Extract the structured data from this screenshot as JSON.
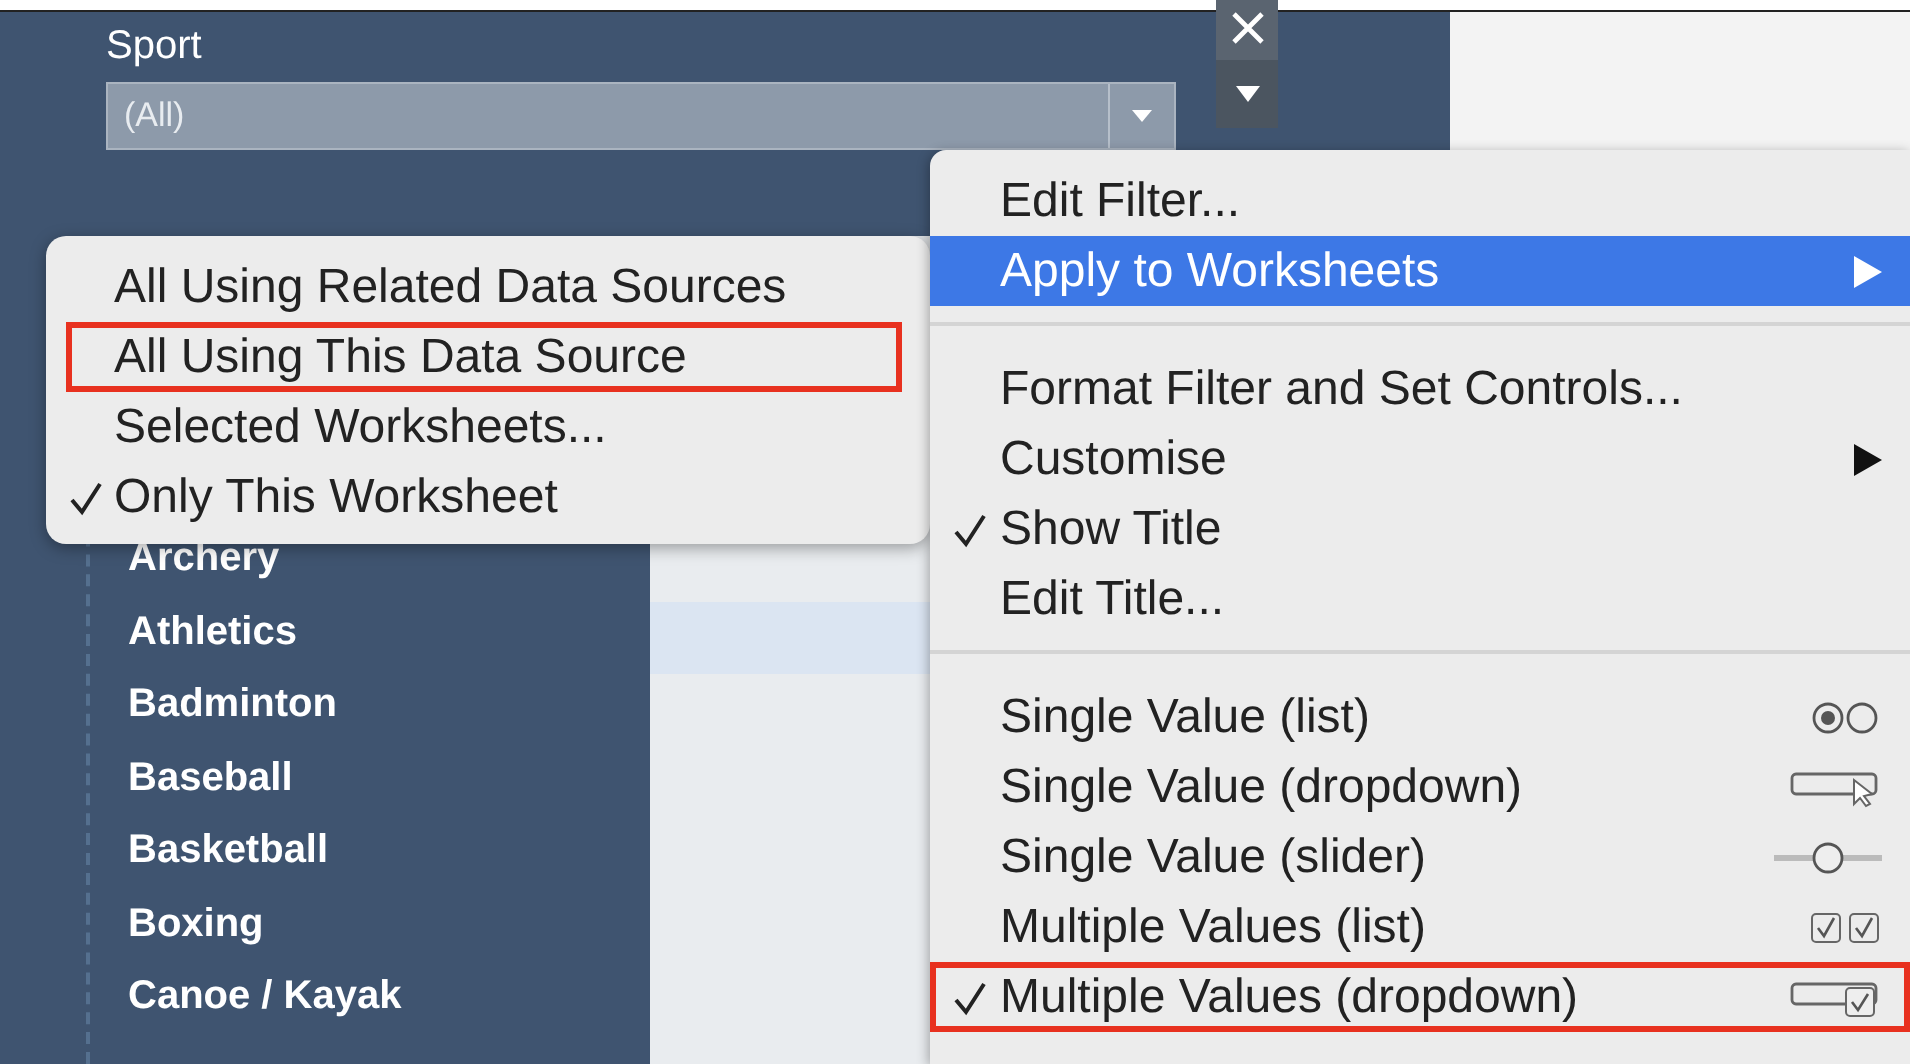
{
  "filter": {
    "title": "Sport",
    "value": "(All)",
    "items": [
      "Archery",
      "Athletics",
      "Badminton",
      "Baseball",
      "Basketball",
      "Boxing",
      "Canoe / Kayak"
    ]
  },
  "submenu": {
    "items": [
      {
        "label": "All Using Related Data Sources",
        "checked": false,
        "annotated": false
      },
      {
        "label": "All Using This Data Source",
        "checked": false,
        "annotated": true
      },
      {
        "label": "Selected Worksheets...",
        "checked": false,
        "annotated": false
      },
      {
        "label": "Only This Worksheet",
        "checked": true,
        "annotated": false
      }
    ]
  },
  "context_menu": {
    "sections": [
      [
        {
          "label": "Edit Filter...",
          "selected": false,
          "checked": false,
          "has_submenu": false,
          "annotated": false
        },
        {
          "label": "Apply to Worksheets",
          "selected": true,
          "checked": false,
          "has_submenu": true,
          "annotated": false
        }
      ],
      [
        {
          "label": "Format Filter and Set Controls...",
          "selected": false,
          "checked": false,
          "has_submenu": false,
          "annotated": false
        },
        {
          "label": "Customise",
          "selected": false,
          "checked": false,
          "has_submenu": true,
          "annotated": false
        },
        {
          "label": "Show Title",
          "selected": false,
          "checked": true,
          "has_submenu": false,
          "annotated": false
        },
        {
          "label": "Edit Title...",
          "selected": false,
          "checked": false,
          "has_submenu": false,
          "annotated": false
        }
      ],
      [
        {
          "label": "Single Value (list)",
          "selected": false,
          "checked": false,
          "has_submenu": false,
          "annotated": false,
          "kind": "radio"
        },
        {
          "label": "Single Value (dropdown)",
          "selected": false,
          "checked": false,
          "has_submenu": false,
          "annotated": false,
          "kind": "dropdown"
        },
        {
          "label": "Single Value (slider)",
          "selected": false,
          "checked": false,
          "has_submenu": false,
          "annotated": false,
          "kind": "slider"
        },
        {
          "label": "Multiple Values (list)",
          "selected": false,
          "checked": false,
          "has_submenu": false,
          "annotated": false,
          "kind": "checkboxes"
        },
        {
          "label": "Multiple Values (dropdown)",
          "selected": false,
          "checked": true,
          "has_submenu": false,
          "annotated": true,
          "kind": "dropdown-check"
        }
      ]
    ]
  }
}
